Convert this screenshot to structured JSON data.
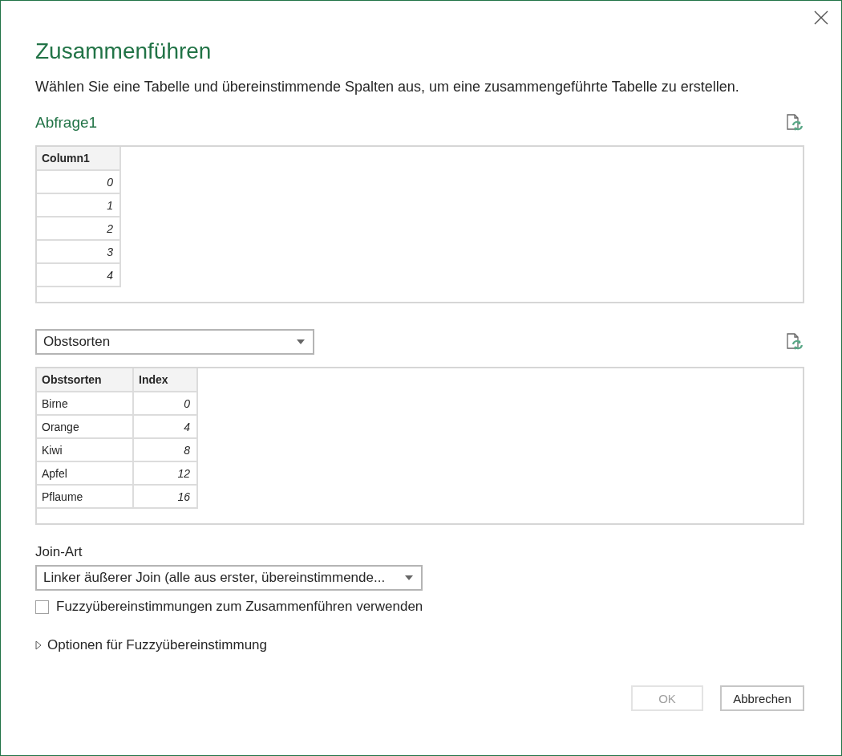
{
  "dialog": {
    "title": "Zusammenführen",
    "description": "Wählen Sie eine Tabelle und übereinstimmende Spalten aus, um eine zusammengeführte Tabelle zu erstellen."
  },
  "first_query": {
    "name": "Abfrage1",
    "table": {
      "columns": [
        {
          "label": "Column1",
          "kind": "number"
        }
      ],
      "rows": [
        [
          "0"
        ],
        [
          "1"
        ],
        [
          "2"
        ],
        [
          "3"
        ],
        [
          "4"
        ]
      ]
    }
  },
  "second_query": {
    "dropdown": {
      "value": "Obstsorten"
    },
    "table": {
      "columns": [
        {
          "label": "Obstsorten",
          "kind": "text"
        },
        {
          "label": "Index",
          "kind": "number"
        }
      ],
      "rows": [
        [
          "Birne",
          "0"
        ],
        [
          "Orange",
          "4"
        ],
        [
          "Kiwi",
          "8"
        ],
        [
          "Apfel",
          "12"
        ],
        [
          "Pflaume",
          "16"
        ]
      ]
    }
  },
  "join_type": {
    "label": "Join-Art",
    "value": "Linker äußerer Join (alle aus erster, übereinstimmende..."
  },
  "fuzzy_checkbox": {
    "label": "Fuzzyübereinstimmungen zum Zusammenführen verwenden",
    "checked": false
  },
  "fuzzy_options": {
    "label": "Optionen für Fuzzyübereinstimmung",
    "expanded": false
  },
  "buttons": [
    {
      "label": "OK",
      "disabled": true
    },
    {
      "label": "Abbrechen",
      "disabled": false
    }
  ]
}
